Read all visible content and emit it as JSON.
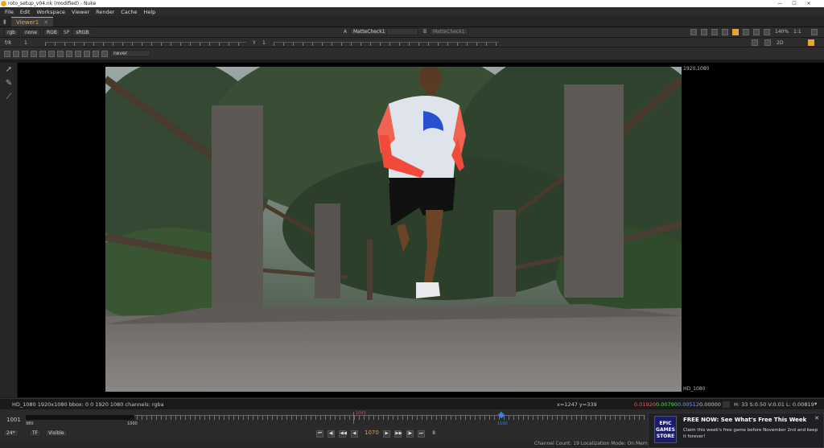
{
  "window": {
    "title": "roto_setup_v04.nk (modified) - Nuke",
    "controls": [
      "—",
      "☐",
      "✕"
    ]
  },
  "menu": [
    "File",
    "Edit",
    "Workspace",
    "Viewer",
    "Render",
    "Cache",
    "Help"
  ],
  "tab": {
    "label": "Viewer1",
    "close": "✕"
  },
  "viewer_controls": {
    "channels": "rgb",
    "alpha": "none",
    "display_channels": "RGB",
    "sp_label": "SP",
    "colorspace": "sRGB",
    "input_a_label": "A",
    "input_a": "MatteCheck1",
    "input_b_label": "B",
    "input_b": "MatteCheck1",
    "zoom": "140%",
    "ratio": "1:1",
    "view_mode": "2D",
    "fstop": "f/8",
    "frame": "1",
    "y_label": "Y",
    "y_value": "1",
    "gain_ticks": [
      "-3",
      "-2",
      "-1",
      "0",
      "1",
      "2",
      "3",
      "4",
      "5",
      "6",
      "7",
      "8"
    ],
    "gamma_ticks": [
      "0.2",
      "0.4",
      "0.6",
      "0.8",
      "1",
      "2",
      "4"
    ],
    "proxy_mode": "never"
  },
  "image": {
    "format_label_top": "1920,1080",
    "format_label_bottom": "HD_1080"
  },
  "info_bar": {
    "left": "HD_1080 1920x1080  bbox: 0 0 1920 1080 channels: rgba",
    "coords": "x=1247 y=339",
    "r": "0.01920",
    "g": "0.00790",
    "b": "0.00512",
    "a": "0.00000",
    "hsvl": "H: 33 S:0.50 V:0.01  L: 0.00819",
    "r_color": "#ff5555",
    "g_color": "#55dd55",
    "b_color": "#6f9fff"
  },
  "timeline": {
    "frame_left": "1001",
    "start": "1001",
    "tick_labels": [
      "980",
      "1000",
      "1043",
      "1050",
      "1100"
    ],
    "current_marker": "1043",
    "blue_marker": "1100"
  },
  "transport": {
    "fps": "24*",
    "tf": "TF",
    "visible": "Visible",
    "current_frame": "1070",
    "step": "8",
    "buttons": [
      "⏮",
      "◀|",
      "◀◀",
      "◀",
      "▶",
      "▶▶",
      "|▶",
      "⏭"
    ]
  },
  "status_bar": {
    "text": "Channel Count: 19  Localization Mode: On  Memory: 3.6 GB (5.6%)  CPU: 0.0%  Disk: 0.2 MB/s  Network: 0.0 MB/s"
  },
  "notification": {
    "logo": "EPIC GAMES STORE",
    "title": "FREE NOW: See What's Free This Week",
    "body": "Claim this week's free game before November 2nd and keep it forever!",
    "close": "✕"
  }
}
